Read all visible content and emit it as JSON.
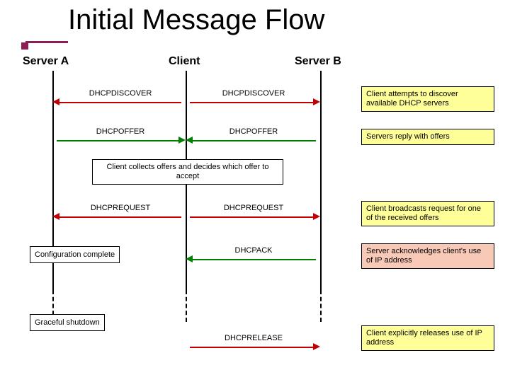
{
  "title": "Initial Message Flow",
  "cols": {
    "a": "Server A",
    "c": "Client",
    "b": "Server B"
  },
  "msgs": {
    "discoverL": "DHCPDISCOVER",
    "discoverR": "DHCPDISCOVER",
    "offerL": "DHCPOFFER",
    "offerR": "DHCPOFFER",
    "requestL": "DHCPREQUEST",
    "requestR": "DHCPREQUEST",
    "ack": "DHCPACK",
    "release": "DHCPRELEASE"
  },
  "notes": {
    "discover": "Client attempts to discover available DHCP servers",
    "offer": "Servers reply with offers",
    "collect": "Client collects offers and decides which offer to accept",
    "request": "Client broadcasts request for one of the received offers",
    "ack": "Server acknowledges client's use of IP address",
    "release": "Client explicitly releases use of IP address",
    "config": "Configuration complete",
    "grace": "Graceful shutdown"
  }
}
